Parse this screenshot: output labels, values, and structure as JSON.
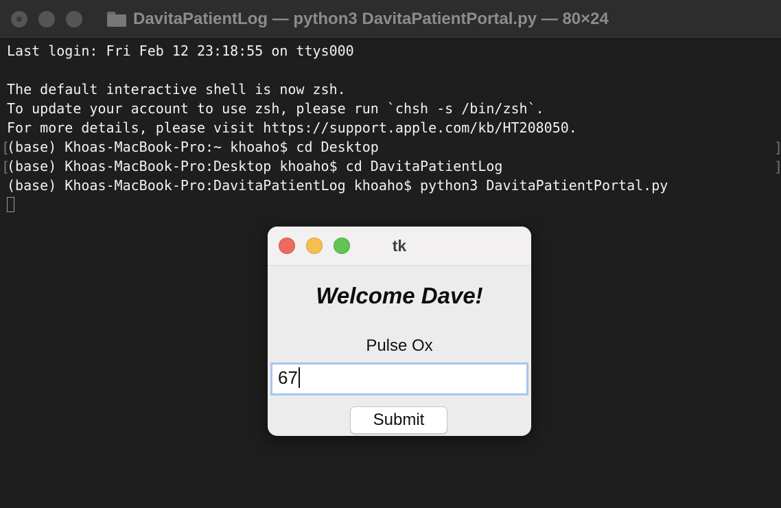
{
  "terminal": {
    "title": "DavitaPatientLog — python3 DavitaPatientPortal.py — 80×24",
    "lines": [
      "Last login: Fri Feb 12 23:18:55 on ttys000",
      "",
      "The default interactive shell is now zsh.",
      "To update your account to use zsh, please run `chsh -s /bin/zsh`.",
      "For more details, please visit https://support.apple.com/kb/HT208050.",
      "(base) Khoas-MacBook-Pro:~ khoaho$ cd Desktop",
      "(base) Khoas-MacBook-Pro:Desktop khoaho$ cd DavitaPatientLog",
      "(base) Khoas-MacBook-Pro:DavitaPatientLog khoaho$ python3 DavitaPatientPortal.py"
    ],
    "icons": {
      "folder": "folder-icon",
      "cursor": "terminal-cursor"
    },
    "colors": {
      "background": "#1e1e1e",
      "text": "#f2f2f2",
      "title": "#8c8c8c"
    }
  },
  "dialog": {
    "title": "tk",
    "welcome": "Welcome Dave!",
    "field_label": "Pulse Ox",
    "field_value": "67",
    "submit_label": "Submit",
    "colors": {
      "close": "#ec6a5e",
      "minimize": "#f4bf4f",
      "maximize": "#61c554",
      "focus_ring": "#a6c6ee"
    }
  }
}
